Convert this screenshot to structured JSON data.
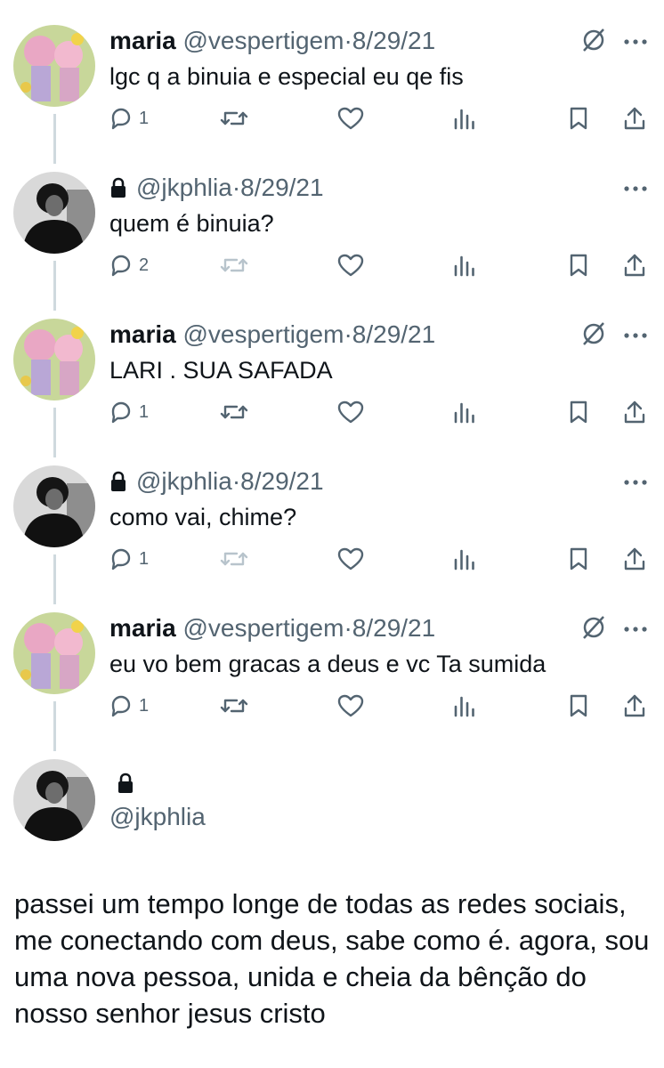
{
  "tweets": [
    {
      "name": "maria",
      "handle": "@vespertigem",
      "date": "8/29/21",
      "text": "lgc q a binuia e especial eu qe fis",
      "replies": "1",
      "locked": false,
      "muted": true
    },
    {
      "name": "",
      "handle": "@jkphlia",
      "date": "8/29/21",
      "text": "quem é binuia?",
      "replies": "2",
      "locked": true,
      "muted": false
    },
    {
      "name": "maria",
      "handle": "@vespertigem",
      "date": "8/29/21",
      "text": "LARI . SUA SAFADA",
      "replies": "1",
      "locked": false,
      "muted": true
    },
    {
      "name": "",
      "handle": "@jkphlia",
      "date": "8/29/21",
      "text": "como vai, chime?",
      "replies": "1",
      "locked": true,
      "muted": false
    },
    {
      "name": "maria",
      "handle": "@vespertigem",
      "date": "8/29/21",
      "text": "eu vo bem gracas a deus e vc Ta sumida",
      "replies": "1",
      "locked": false,
      "muted": true
    }
  ],
  "final": {
    "handle": "@jkphlia",
    "text": "passei um tempo longe de todas as redes sociais, me conectando com deus, sabe como é. agora, sou uma nova pessoa, unida e cheia da bênção do nosso senhor jesus cristo"
  },
  "separator": "·",
  "icons": {
    "reply": "reply-icon",
    "retweet": "retweet-icon",
    "like": "like-icon",
    "views": "views-icon",
    "bookmark": "bookmark-icon",
    "share": "share-icon",
    "more": "more-icon",
    "muted": "muted-icon",
    "lock": "lock-icon"
  },
  "colors": {
    "text": "#0f1419",
    "secondary": "#536471",
    "disabled": "#b8c4cc",
    "thread_line": "#cfd9de"
  }
}
